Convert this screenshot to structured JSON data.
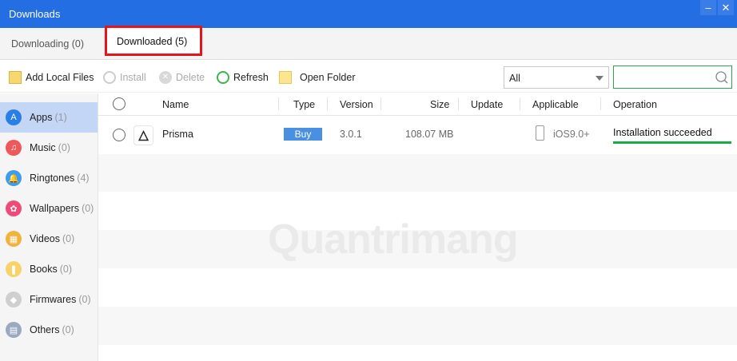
{
  "window": {
    "title": "Downloads",
    "minimize": "–",
    "close": "✕"
  },
  "tabs": [
    {
      "label": "Downloading (0)"
    },
    {
      "label": "Downloaded (5)"
    }
  ],
  "toolbar": {
    "add_local": "Add Local Files",
    "install": "Install",
    "delete": "Delete",
    "refresh": "Refresh",
    "open_folder": "Open Folder",
    "filter_value": "All",
    "search_placeholder": ""
  },
  "sidebar": [
    {
      "label": "Apps",
      "count": "(1)",
      "color": "#2a7ee8",
      "glyph": "A"
    },
    {
      "label": "Music",
      "count": "(0)",
      "color": "#f0575a",
      "glyph": "♫"
    },
    {
      "label": "Ringtones",
      "count": "(4)",
      "color": "#3d9cf0",
      "glyph": "🔔"
    },
    {
      "label": "Wallpapers",
      "count": "(0)",
      "color": "#f04a78",
      "glyph": "✿"
    },
    {
      "label": "Videos",
      "count": "(0)",
      "color": "#f2b33d",
      "glyph": "▦"
    },
    {
      "label": "Books",
      "count": "(0)",
      "color": "#f8d36a",
      "glyph": "❚"
    },
    {
      "label": "Firmwares",
      "count": "(0)",
      "color": "#cfcfcf",
      "glyph": "◆"
    },
    {
      "label": "Others",
      "count": "(0)",
      "color": "#9aa9c0",
      "glyph": "▤"
    }
  ],
  "columns": {
    "name": "Name",
    "type": "Type",
    "version": "Version",
    "size": "Size",
    "update": "Update",
    "applicable": "Applicable",
    "operation": "Operation"
  },
  "rows": [
    {
      "name": "Prisma",
      "type": "Buy",
      "version": "3.0.1",
      "size": "108.07 MB",
      "update": "",
      "applicable": "iOS9.0+",
      "operation": "Installation succeeded",
      "progress": 1.0
    }
  ],
  "watermark": "Quantrimang"
}
